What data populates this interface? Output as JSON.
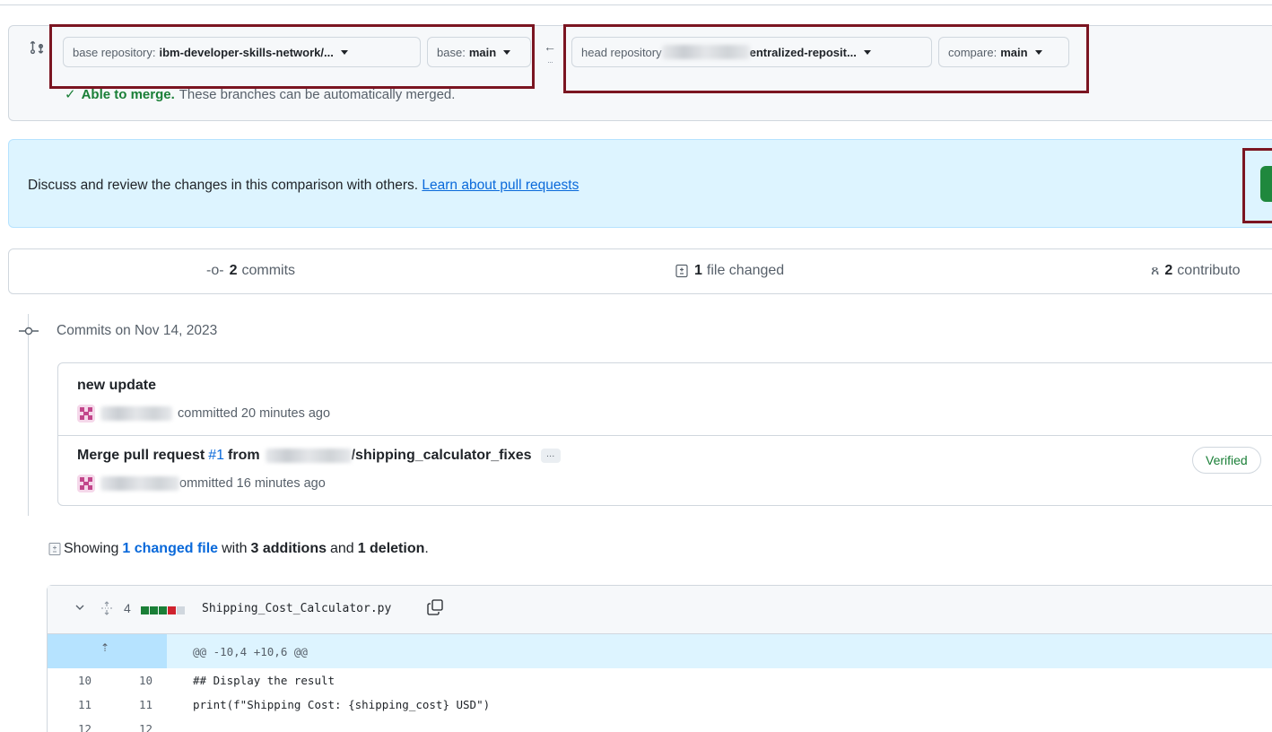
{
  "range": {
    "base_repo_label": "base repository:",
    "base_repo_value": "ibm-developer-skills-network/...",
    "base_label": "base:",
    "base_value": "main",
    "head_repo_label": "head repository",
    "head_repo_value": "entralized-reposit...",
    "compare_label": "compare:",
    "compare_value": "main",
    "merge_status": "Able to merge.",
    "merge_detail": "These branches can be automatically merged."
  },
  "banner": {
    "text": "Discuss and review the changes in this comparison with others.",
    "link": "Learn about pull requests"
  },
  "summary": {
    "commits_count": "2",
    "commits_label": "commits",
    "files_count": "1",
    "files_label": "file changed",
    "contributors_count": "2",
    "contributors_label": "contributo"
  },
  "timeline": {
    "date_heading": "Commits on Nov 14, 2023"
  },
  "commits": [
    {
      "title": "new update",
      "meta": "committed 20 minutes ago"
    },
    {
      "title_prefix": "Merge pull request",
      "pr": "#1",
      "title_from": "from",
      "branch": "/shipping_calculator_fixes",
      "ellipsis": "…",
      "meta": "ommitted 16 minutes ago",
      "badge": "Verified"
    }
  ],
  "changes": {
    "prefix": "Showing",
    "files_link": "1 changed file",
    "with": "with",
    "additions": "3 additions",
    "and": "and",
    "deletions": "1 deletion",
    "period": "."
  },
  "file": {
    "change_count": "4",
    "name": "Shipping_Cost_Calculator.py",
    "diffstat_colors": [
      "#1a7f37",
      "#1a7f37",
      "#1a7f37",
      "#cf222e",
      "#d0d7de"
    ],
    "hunk": "@@ -10,4 +10,6 @@",
    "lines": [
      {
        "old": "10",
        "new": "10",
        "code": "## Display the result"
      },
      {
        "old": "11",
        "new": "11",
        "code": "print(f\"Shipping Cost: {shipping_cost} USD\")"
      },
      {
        "old": "12",
        "new": "12",
        "code": ""
      }
    ]
  },
  "colors": {
    "accent": "#0969da",
    "success": "#1a7f37",
    "highlight_box": "#7b1521",
    "banner_bg": "#ddf4ff"
  }
}
